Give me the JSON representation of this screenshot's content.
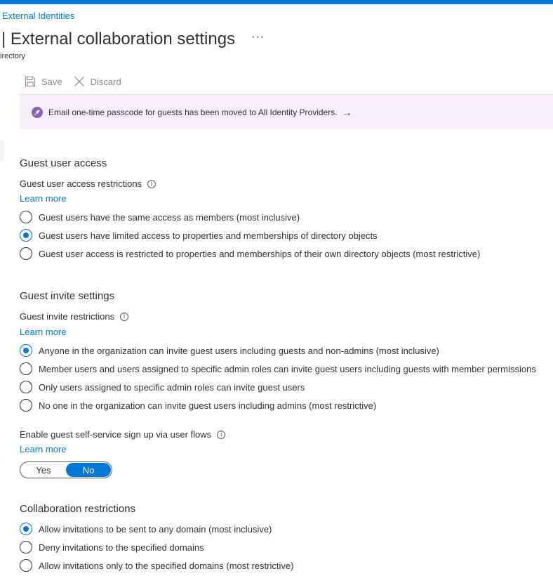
{
  "breadcrumb": "External Identities",
  "header": {
    "title": "| External collaboration settings",
    "more": "···",
    "subtitle": "irectory"
  },
  "toolbar": {
    "save_label": "Save",
    "discard_label": "Discard"
  },
  "banner": {
    "text": "Email one-time passcode for guests has been moved to All Identity Providers.",
    "arrow": "→",
    "accent": "#8764b8"
  },
  "guest_user_access": {
    "heading": "Guest user access",
    "label": "Guest user access restrictions",
    "learn_more": "Learn more",
    "options": [
      "Guest users have the same access as members (most inclusive)",
      "Guest users have limited access to properties and memberships of directory objects",
      "Guest user access is restricted to properties and memberships of their own directory objects (most restrictive)"
    ],
    "selected": 1
  },
  "guest_invite": {
    "heading": "Guest invite settings",
    "label": "Guest invite restrictions",
    "learn_more": "Learn more",
    "options": [
      "Anyone in the organization can invite guest users including guests and non-admins (most inclusive)",
      "Member users and users assigned to specific admin roles can invite guest users including guests with member permissions",
      "Only users assigned to specific admin roles can invite guest users",
      "No one in the organization can invite guest users including admins (most restrictive)"
    ],
    "selected": 0
  },
  "self_service": {
    "label": "Enable guest self-service sign up via user flows",
    "learn_more": "Learn more",
    "yes": "Yes",
    "no": "No",
    "selected": "No"
  },
  "collaboration": {
    "heading": "Collaboration restrictions",
    "options": [
      "Allow invitations to be sent to any domain (most inclusive)",
      "Deny invitations to the specified domains",
      "Allow invitations only to the specified domains (most restrictive)"
    ],
    "selected": 0
  },
  "colors": {
    "accent": "#0078d4",
    "banner_bg": "#f4eff8",
    "text": "#323130"
  }
}
